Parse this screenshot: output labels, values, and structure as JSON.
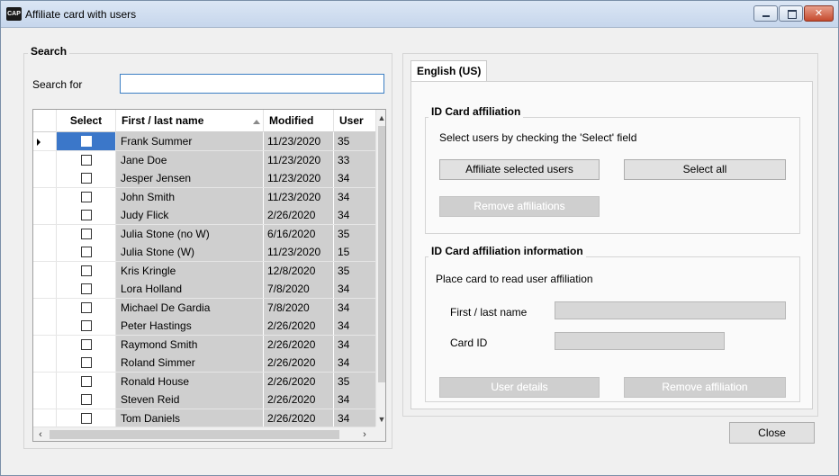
{
  "window": {
    "title": "Affiliate card with users",
    "icon_text": "CAP"
  },
  "search": {
    "legend": "Search",
    "label": "Search for",
    "value": ""
  },
  "grid": {
    "columns": [
      "Select",
      "First / last name",
      "Modified",
      "User"
    ],
    "rows": [
      {
        "name": "Frank Summer",
        "modified": "11/23/2020",
        "user": "35",
        "selected": false,
        "current": true
      },
      {
        "name": "Jane Doe",
        "modified": "11/23/2020",
        "user": "33",
        "selected": false,
        "current": false
      },
      {
        "name": "Jesper Jensen",
        "modified": "11/23/2020",
        "user": "34",
        "selected": false,
        "current": false
      },
      {
        "name": "John Smith",
        "modified": "11/23/2020",
        "user": "34",
        "selected": false,
        "current": false
      },
      {
        "name": "Judy Flick",
        "modified": "2/26/2020",
        "user": "34",
        "selected": false,
        "current": false
      },
      {
        "name": "Julia Stone (no W)",
        "modified": "6/16/2020",
        "user": "35",
        "selected": false,
        "current": false
      },
      {
        "name": "Julia Stone (W)",
        "modified": "11/23/2020",
        "user": "15",
        "selected": false,
        "current": false
      },
      {
        "name": "Kris Kringle",
        "modified": "12/8/2020",
        "user": "35",
        "selected": false,
        "current": false
      },
      {
        "name": "Lora Holland",
        "modified": "7/8/2020",
        "user": "34",
        "selected": false,
        "current": false
      },
      {
        "name": "Michael De Gardia",
        "modified": "7/8/2020",
        "user": "34",
        "selected": false,
        "current": false
      },
      {
        "name": "Peter Hastings",
        "modified": "2/26/2020",
        "user": "34",
        "selected": false,
        "current": false
      },
      {
        "name": "Raymond Smith",
        "modified": "2/26/2020",
        "user": "34",
        "selected": false,
        "current": false
      },
      {
        "name": "Roland  Simmer",
        "modified": "2/26/2020",
        "user": "34",
        "selected": false,
        "current": false
      },
      {
        "name": "Ronald House",
        "modified": "2/26/2020",
        "user": "35",
        "selected": false,
        "current": false
      },
      {
        "name": "Steven Reid",
        "modified": "2/26/2020",
        "user": "34",
        "selected": false,
        "current": false
      },
      {
        "name": "Tom Daniels",
        "modified": "2/26/2020",
        "user": "34",
        "selected": false,
        "current": false
      }
    ]
  },
  "tabs": [
    {
      "label": "English (US)"
    }
  ],
  "affiliation": {
    "legend": "ID Card affiliation",
    "instruction": "Select users by checking the 'Select' field",
    "affiliate_button": "Affiliate selected users",
    "select_all_button": "Select all",
    "remove_button": "Remove affiliations"
  },
  "info": {
    "legend": "ID Card affiliation information",
    "instruction": "Place card to read user affiliation",
    "name_label": "First / last name",
    "name_value": "",
    "card_label": "Card ID",
    "card_value": "",
    "details_button": "User details",
    "remove_button": "Remove affiliation"
  },
  "footer": {
    "close_button": "Close"
  },
  "colors": {
    "current_row": "#3b77c9",
    "cell_bg": "#cfcfcf",
    "input_focus": "#3c7fc4"
  }
}
